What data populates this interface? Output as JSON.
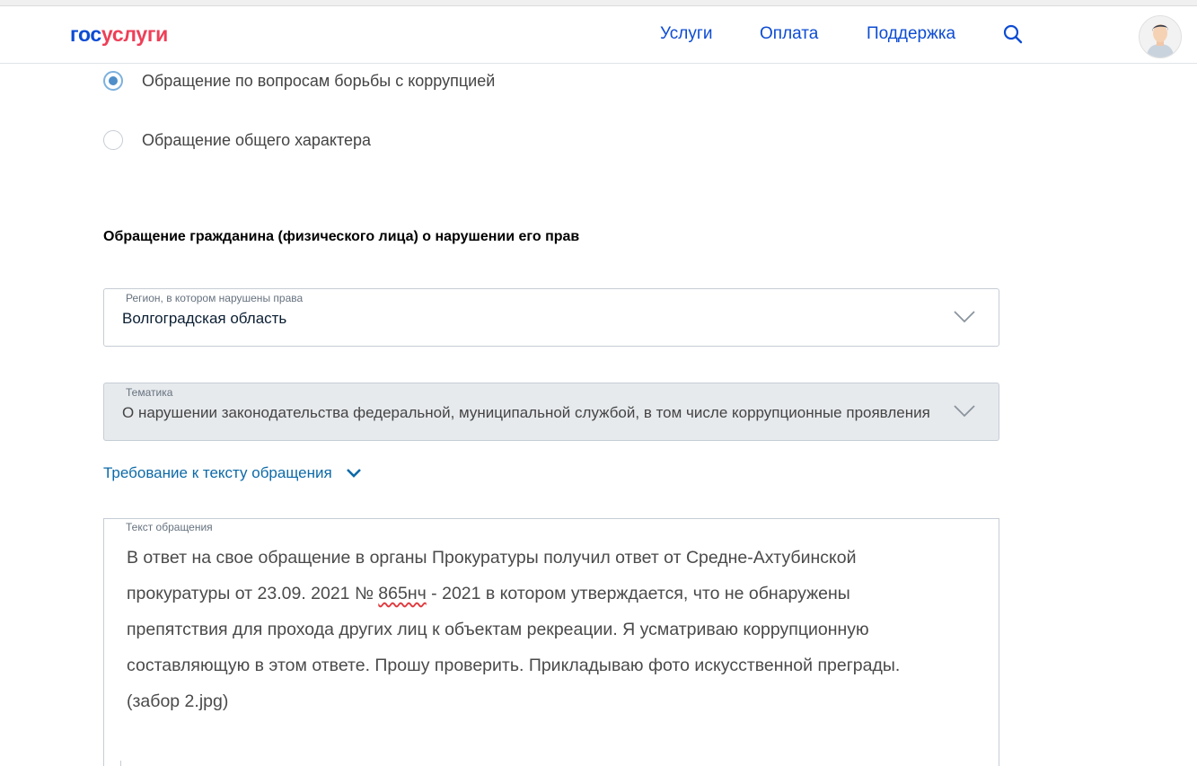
{
  "header": {
    "logo_part1": "гос",
    "logo_part2": "услуги",
    "nav": [
      "Услуги",
      "Оплата",
      "Поддержка"
    ],
    "search_icon": "search-icon",
    "avatar_icon": "user-avatar-icon"
  },
  "appeal_type": {
    "options": [
      {
        "label": "Обращение по вопросам борьбы с коррупцией",
        "checked": true
      },
      {
        "label": "Обращение общего характера",
        "checked": false
      }
    ]
  },
  "form": {
    "section_title": "Обращение гражданина (физического лица) о нарушении его прав",
    "region": {
      "label": "Регион, в котором нарушены права",
      "value": "Волгоградская область"
    },
    "topic": {
      "label": "Тематика",
      "value": "О нарушении законодательства федеральной, муниципальной службой, в том числе коррупционные проявления",
      "disabled": true
    },
    "requirements_link": "Требование к тексту обращения",
    "text": {
      "label": "Текст обращения",
      "before_typo": "В ответ на свое обращение в органы Прокуратуры получил ответ от Средне-Ахтубинской прокуратуры от 23.09. 2021 № ",
      "typo": "865нч",
      "after_typo": " - 2021 в котором утверждается, что не обнаружены препятствия для прохода других лиц к объектам рекреации. Я усматриваю коррупционную составляющую в этом ответе. Прошу проверить. Прикладываю фото искусственной преграды.(забор 2.jpg)"
    }
  },
  "colors": {
    "brand_blue": "#0d4cd3",
    "brand_red": "#ee3f58",
    "link_blue": "#0d6aa8",
    "disabled_bg": "#e7eaed"
  }
}
